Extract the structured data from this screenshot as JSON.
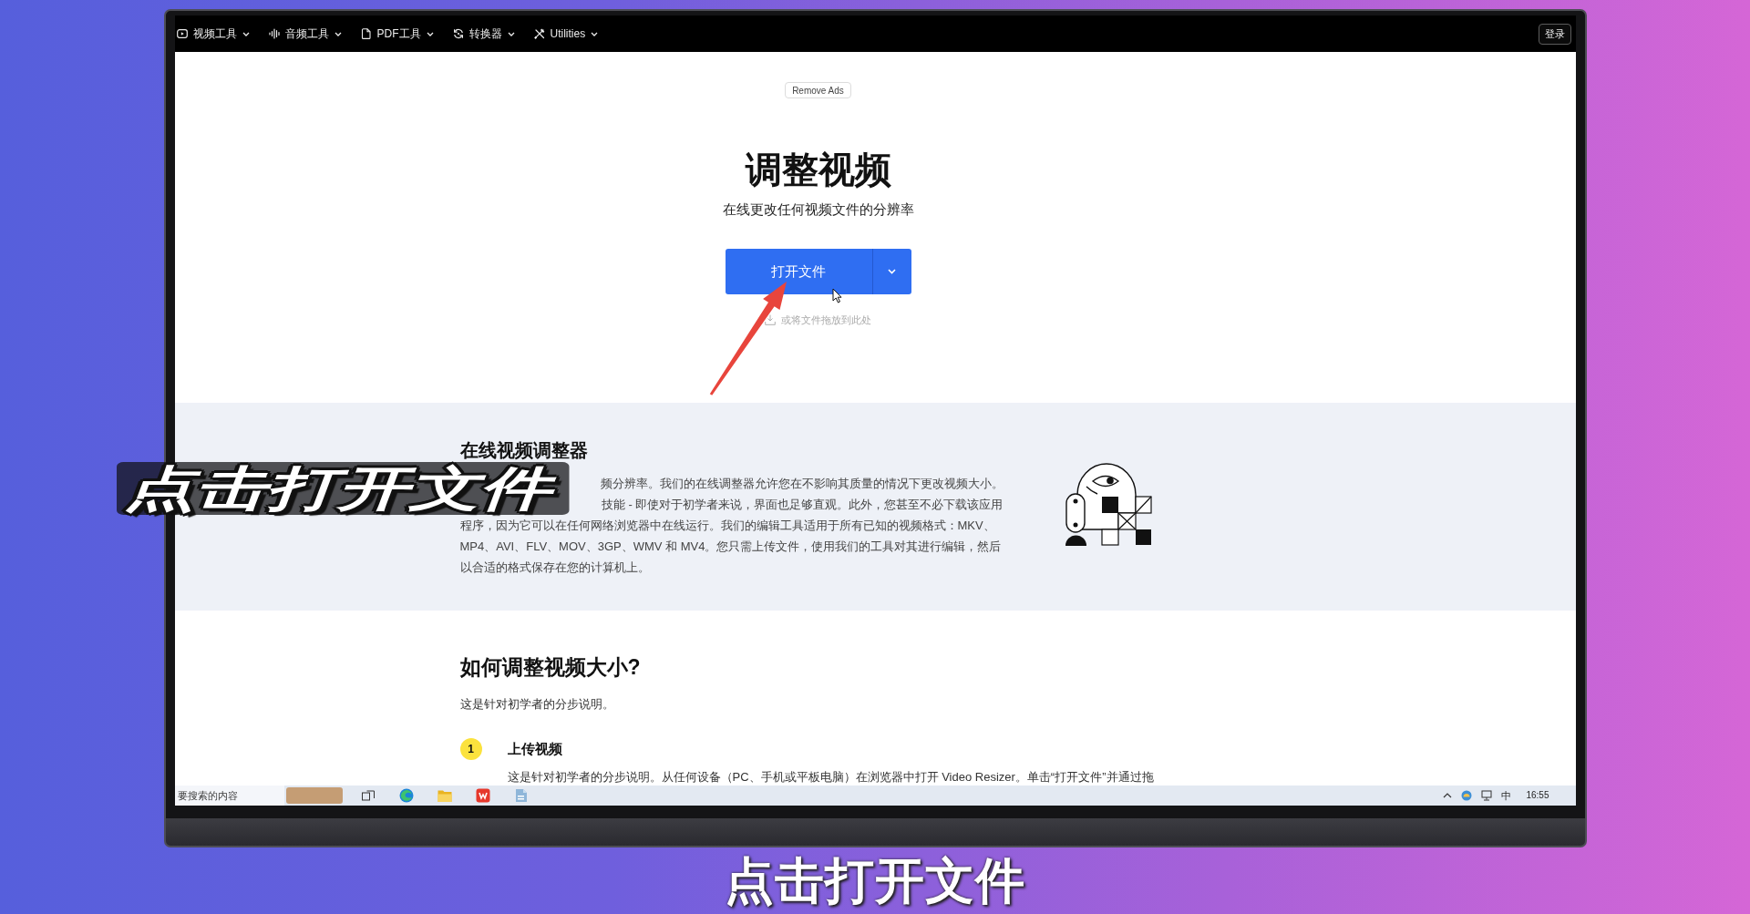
{
  "nav": {
    "items": [
      {
        "label": "视频工具"
      },
      {
        "label": "音频工具"
      },
      {
        "label": "PDF工具"
      },
      {
        "label": "转换器"
      },
      {
        "label": "Utilities"
      }
    ],
    "login_button": "登录"
  },
  "hero": {
    "remove_ads_button": "Remove Ads",
    "title": "调整视频",
    "subtitle": "在线更改任何视频文件的分辨率",
    "open_file_button": "打开文件",
    "drop_hint": "或将文件拖放到此处"
  },
  "about": {
    "heading": "在线视频调整器",
    "visible_lines": [
      "频分辨率。我们的在线调整器允许您在不影响其质量的情况下更改视频大小。",
      "技能 - 即使对于初学者来说，界面也足够直观。此外，您甚至不必下载该应用"
    ],
    "paragraph": "程序，因为它可以在任何网络浏览器中在线运行。我们的编辑工具适用于所有已知的视频格式：MKV、MP4、AVI、FLV、MOV、3GP、WMV 和 MV4。您只需上传文件，使用我们的工具对其进行编辑，然后以合适的格式保存在您的计算机上。"
  },
  "howto": {
    "heading": "如何调整视频大小?",
    "intro": "这是针对初学者的分步说明。",
    "steps": [
      {
        "number": "1",
        "title": "上传视频",
        "text": "这是针对初学者的分步说明。从任何设备（PC、手机或平板电脑）在浏览器中打开 Video Resizer。单击“打开文件”并通过拖"
      }
    ]
  },
  "taskbar": {
    "search": {
      "placeholder": "要搜索的内容"
    },
    "ime_indicator": "中",
    "clock": "16:55"
  },
  "overlay_caption": "点击打开文件",
  "subtitle": "点击打开文件"
}
